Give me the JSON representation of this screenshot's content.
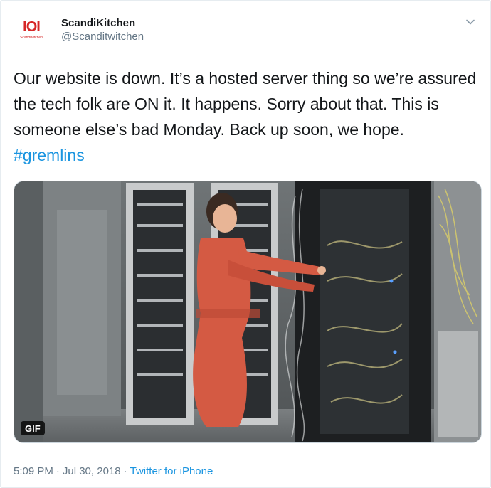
{
  "author": {
    "display_name": "ScandiKitchen",
    "handle": "@Scanditwitchen",
    "logo_mark": "IOI",
    "logo_word": "ScandiKitchen"
  },
  "tweet": {
    "text": "Our website is down. It’s a hosted server thing so we’re assured the tech folk are ON it. It happens. Sorry about that. This is someone else’s bad Monday. Back up soon, we hope. ",
    "hashtag": "#gremlins"
  },
  "media": {
    "badge": "GIF",
    "icon": "gif-badge"
  },
  "meta": {
    "time": "5:09 PM",
    "separator": "·",
    "date": "Jul 30, 2018",
    "source": "Twitter for iPhone"
  },
  "colors": {
    "accent": "#1b95e0",
    "brand": "#d62626",
    "text": "#14171a",
    "secondary": "#657786"
  },
  "icons": {
    "menu": "chevron-down-icon"
  }
}
